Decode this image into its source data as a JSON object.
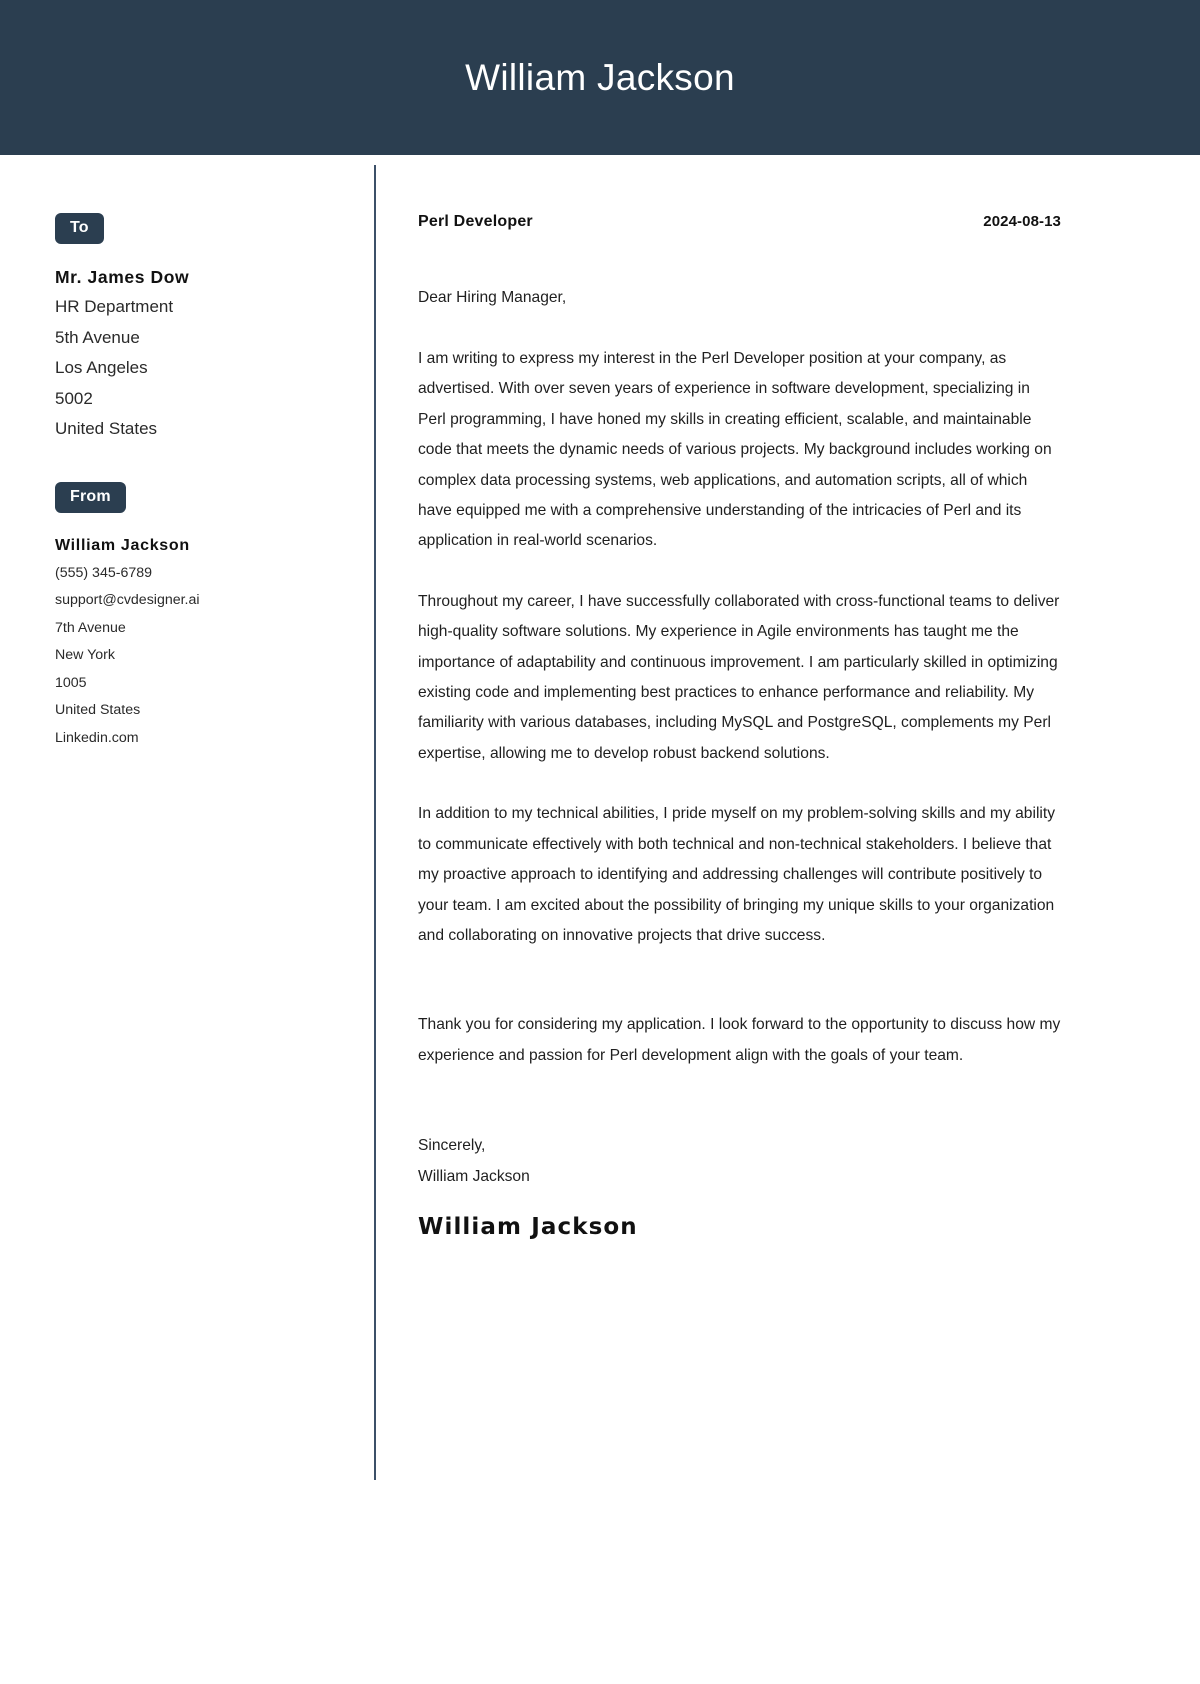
{
  "header": {
    "name": "William Jackson"
  },
  "sidebar": {
    "to": {
      "badge_label": "To",
      "name": "Mr. James Dow",
      "lines": [
        "HR Department",
        "5th Avenue",
        "Los Angeles",
        "5002",
        "United States"
      ]
    },
    "from": {
      "badge_label": "From",
      "name": "William Jackson",
      "lines": [
        "(555) 345-6789",
        "support@cvdesigner.ai",
        "7th Avenue",
        "New York",
        "1005",
        "United States",
        "Linkedin.com"
      ]
    }
  },
  "letter": {
    "job_title": "Perl Developer",
    "date": "2024-08-13",
    "salutation": "Dear Hiring Manager,",
    "paragraphs": [
      "I am writing to express my interest in the Perl Developer position at your company, as advertised. With over seven years of experience in software development, specializing in Perl programming, I have honed my skills in creating efficient, scalable, and maintainable code that meets the dynamic needs of various projects. My background includes working on complex data processing systems, web applications, and automation scripts, all of which have equipped me with a comprehensive understanding of the intricacies of Perl and its application in real-world scenarios.",
      "Throughout my career, I have successfully collaborated with cross-functional teams to deliver high-quality software solutions. My experience in Agile environments has taught me the importance of adaptability and continuous improvement. I am particularly skilled in optimizing existing code and implementing best practices to enhance performance and reliability. My familiarity with various databases, including MySQL and PostgreSQL, complements my Perl expertise, allowing me to develop robust backend solutions.",
      "In addition to my technical abilities, I pride myself on my problem-solving skills and my ability to communicate effectively with both technical and non-technical stakeholders. I believe that my proactive approach to identifying and addressing challenges will contribute positively to your team. I am excited about the possibility of bringing my unique skills to your organization and collaborating on innovative projects that drive success.",
      "Thank you for considering my application. I look forward to the opportunity to discuss how my experience and passion for Perl development align with the goals of your team."
    ],
    "closing_word": "Sincerely,",
    "closing_name": "William Jackson",
    "signature": "William Jackson"
  },
  "colors": {
    "header_background": "#2b3e50",
    "badge_background": "#2b3e50",
    "divider": "#3c5068",
    "body_text": "#1f1f1f",
    "page_background": "#ffffff"
  }
}
